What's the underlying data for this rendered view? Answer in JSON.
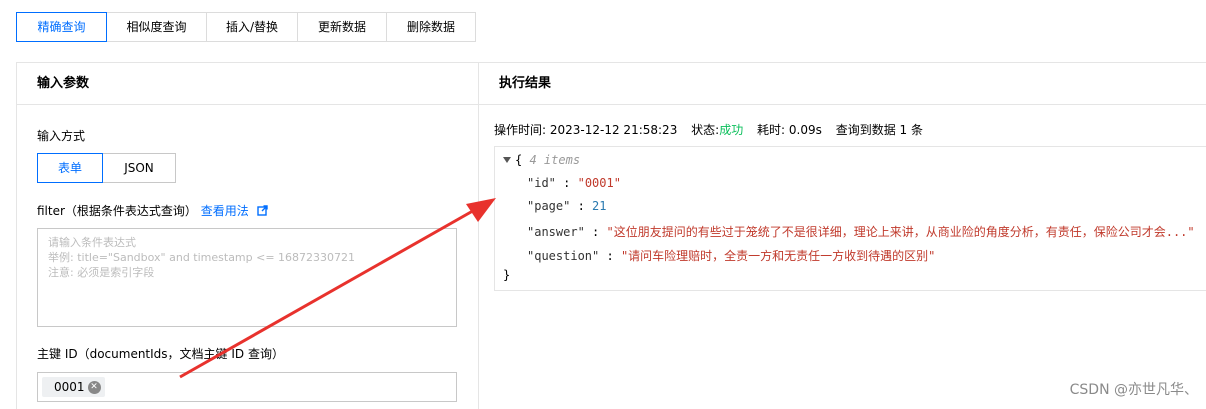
{
  "tabs": [
    "精确查询",
    "相似度查询",
    "插入/替换",
    "更新数据",
    "删除数据"
  ],
  "input_panel": {
    "title": "输入参数",
    "input_method_label": "输入方式",
    "methods": [
      "表单",
      "JSON"
    ],
    "filter_label": "filter（根据条件表达式查询）",
    "filter_help_link": "查看用法",
    "filter_placeholder": "请输入条件表达式\n举例: title=\"Sandbox\" and timestamp <= 16872330721\n注意: 必须是索引字段",
    "primary_key_label": "主键 ID（documentIds，文档主键 ID 查询）",
    "primary_key_tag": "0001"
  },
  "result_panel": {
    "title": "执行结果",
    "time_label": "操作时间:",
    "time_value": "2023-12-12 21:58:23",
    "status_label": "状态:",
    "status_value": "成功",
    "duration_label": "耗时:",
    "duration_value": "0.09s",
    "count_text": "查询到数据 1 条",
    "json": {
      "open_brace": "{",
      "items_count": "4 items",
      "rows": [
        {
          "key": "\"id\"",
          "value": "\"0001\"",
          "type": "str"
        },
        {
          "key": "\"page\"",
          "value": "21",
          "type": "num"
        },
        {
          "key": "\"answer\"",
          "value": "\"这位朋友提问的有些过于笼统了不是很详细，理论上来讲，从商业险的角度分析，有责任，保险公司才会...\"",
          "type": "str"
        },
        {
          "key": "\"question\"",
          "value": "\"请问车险理赔时，全责一方和无责任一方收到待遇的区别\"",
          "type": "str"
        }
      ],
      "close_brace": "}"
    }
  },
  "watermark": "CSDN @亦世凡华、",
  "colors": {
    "accent": "#006eff",
    "success": "#0abf5b",
    "arrow": "#e8322d"
  }
}
